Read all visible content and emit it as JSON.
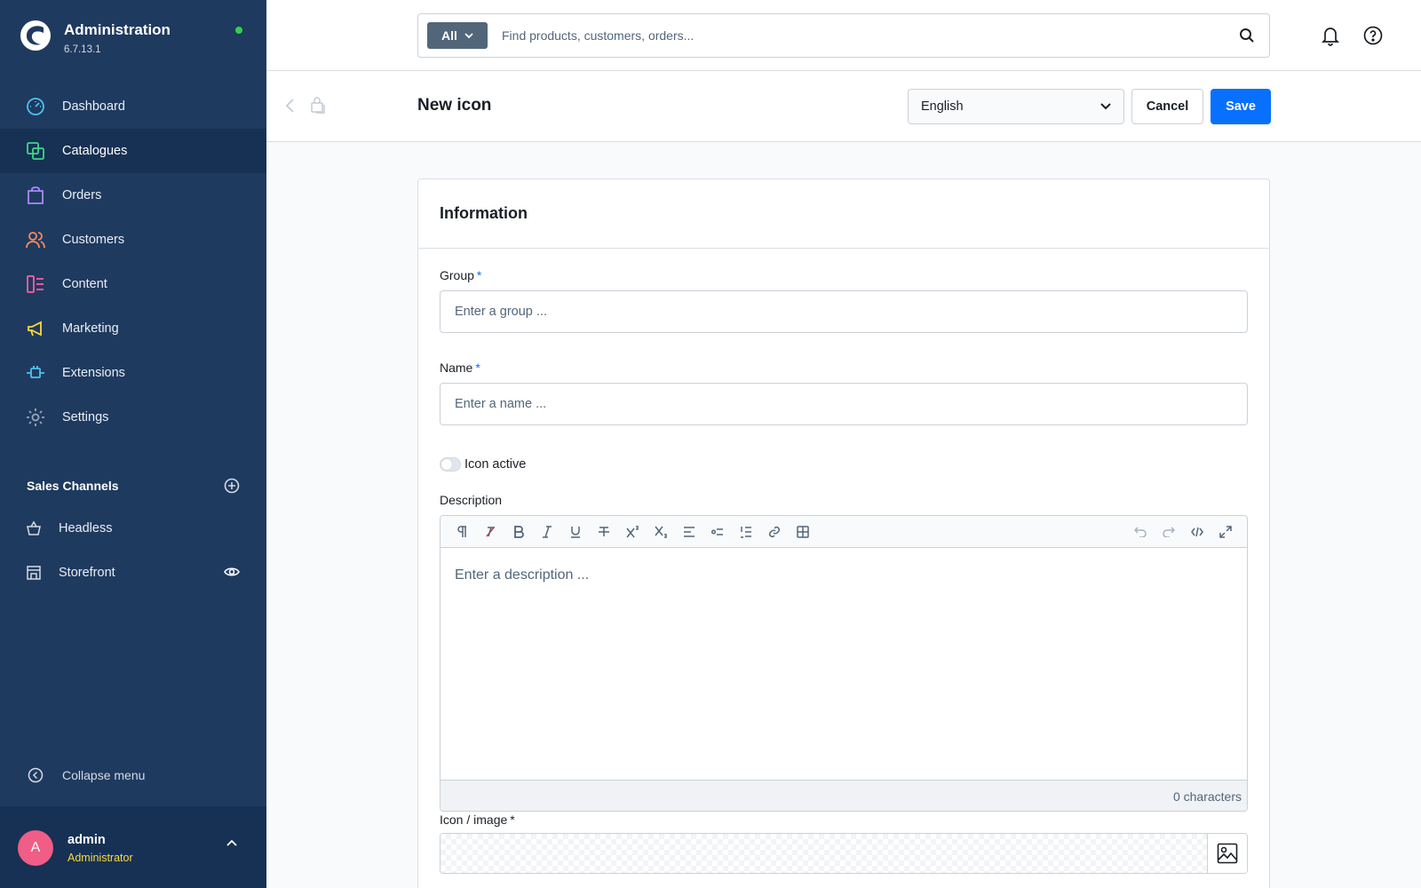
{
  "app": {
    "title": "Administration",
    "version": "6.7.13.1"
  },
  "colors": {
    "sidebar_bg": "#1f3a5f",
    "sidebar_active": "#163153",
    "primary": "#0870ff",
    "online": "#37d046",
    "avatar": "#f05d86",
    "role": "#ffd93d"
  },
  "nav": {
    "items": [
      {
        "label": "Dashboard",
        "icon": "gauge-icon"
      },
      {
        "label": "Catalogues",
        "icon": "products-icon",
        "active": true
      },
      {
        "label": "Orders",
        "icon": "shopping-bag-icon"
      },
      {
        "label": "Customers",
        "icon": "users-icon"
      },
      {
        "label": "Content",
        "icon": "content-icon"
      },
      {
        "label": "Marketing",
        "icon": "megaphone-icon"
      },
      {
        "label": "Extensions",
        "icon": "plug-icon"
      },
      {
        "label": "Settings",
        "icon": "gear-icon"
      }
    ]
  },
  "sales_channels": {
    "title": "Sales Channels",
    "items": [
      {
        "label": "Headless",
        "icon": "basket-icon"
      },
      {
        "label": "Storefront",
        "icon": "storefront-icon"
      }
    ]
  },
  "sidebar": {
    "collapse_label": "Collapse menu"
  },
  "user": {
    "initial": "A",
    "name": "admin",
    "role": "Administrator"
  },
  "search": {
    "type_label": "All",
    "placeholder": "Find products, customers, orders..."
  },
  "smartbar": {
    "title": "New icon",
    "language": "English",
    "cancel_label": "Cancel",
    "save_label": "Save"
  },
  "form": {
    "card_title": "Information",
    "group_label": "Group",
    "group_placeholder": "Enter a group ...",
    "name_label": "Name",
    "name_placeholder": "Enter a name ...",
    "required_mark": "*",
    "active_label": "Icon active",
    "active_value": false,
    "description_label": "Description",
    "description_placeholder": "Enter a description ...",
    "char_count": "0 characters",
    "image_label": "Icon / image"
  },
  "editor_toolbar": [
    "paragraph-icon",
    "remove-format-icon",
    "bold-icon",
    "italic-icon",
    "underline-icon",
    "strikethrough-icon",
    "superscript-icon",
    "subscript-icon",
    "align-left-icon",
    "bullet-list-icon",
    "numbered-list-icon",
    "link-icon",
    "table-icon",
    "undo-icon",
    "redo-icon",
    "code-view-icon",
    "fullscreen-icon"
  ]
}
